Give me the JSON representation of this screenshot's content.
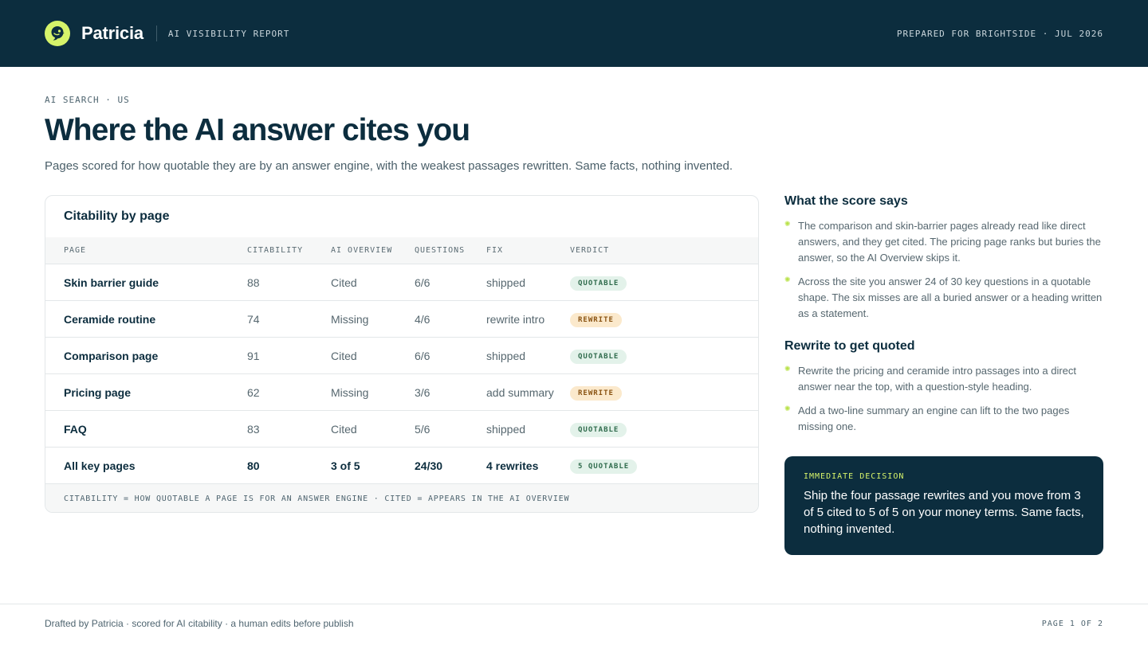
{
  "header": {
    "brand": "Patricia",
    "report_label": "AI VISIBILITY REPORT",
    "prepared": "PREPARED FOR BRIGHTSIDE · JUL 2026",
    "logo_icon": "bird-mascot-icon",
    "accent_color": "#d6f36a",
    "bar_color": "#0c2d3e"
  },
  "hero": {
    "eyebrow": "AI SEARCH · US",
    "title": "Where the AI answer cites you",
    "subtitle": "Pages scored for how quotable they are by an answer engine, with the weakest passages rewritten. Same facts, nothing invented."
  },
  "table": {
    "title": "Citability by page",
    "columns": [
      "PAGE",
      "CITABILITY",
      "AI OVERVIEW",
      "QUESTIONS",
      "FIX",
      "VERDICT"
    ],
    "rows": [
      {
        "page": "Skin barrier guide",
        "citability": "88",
        "overview": "Cited",
        "questions": "6/6",
        "fix": "shipped",
        "verdict": "QUOTABLE",
        "status": "good"
      },
      {
        "page": "Ceramide routine",
        "citability": "74",
        "overview": "Missing",
        "questions": "4/6",
        "fix": "rewrite intro",
        "verdict": "REWRITE",
        "status": "warn"
      },
      {
        "page": "Comparison page",
        "citability": "91",
        "overview": "Cited",
        "questions": "6/6",
        "fix": "shipped",
        "verdict": "QUOTABLE",
        "status": "good"
      },
      {
        "page": "Pricing page",
        "citability": "62",
        "overview": "Missing",
        "questions": "3/6",
        "fix": "add summary",
        "verdict": "REWRITE",
        "status": "warn"
      },
      {
        "page": "FAQ",
        "citability": "83",
        "overview": "Cited",
        "questions": "5/6",
        "fix": "shipped",
        "verdict": "QUOTABLE",
        "status": "good"
      }
    ],
    "total": {
      "page": "All key pages",
      "citability": "80",
      "overview": "3 of 5",
      "questions": "24/30",
      "fix": "4 rewrites",
      "verdict": "5 QUOTABLE",
      "status": "good"
    },
    "footnote": "CITABILITY = HOW QUOTABLE A PAGE IS FOR AN ANSWER ENGINE · CITED = APPEARS IN THE AI OVERVIEW"
  },
  "side": {
    "score_title": "What the score says",
    "score_bullets": [
      "The comparison and skin-barrier pages already read like direct answers, and they get cited. The pricing page ranks but buries the answer, so the AI Overview skips it.",
      "Across the site you answer 24 of 30 key questions in a quotable shape. The six misses are all a buried answer or a heading written as a statement."
    ],
    "rewrite_title": "Rewrite to get quoted",
    "rewrite_bullets": [
      "Rewrite the pricing and ceramide intro passages into a direct answer near the top, with a question-style heading.",
      "Add a two-line summary an engine can lift to the two pages missing one."
    ],
    "decision_label": "IMMEDIATE DECISION",
    "decision_text": "Ship the four passage rewrites and you move from 3 of 5 cited to 5 of 5 on your money terms. Same facts, nothing invented."
  },
  "footer": {
    "left": "Drafted by Patricia · scored for AI citability · a human edits before publish",
    "right": "PAGE 1 OF 2"
  }
}
